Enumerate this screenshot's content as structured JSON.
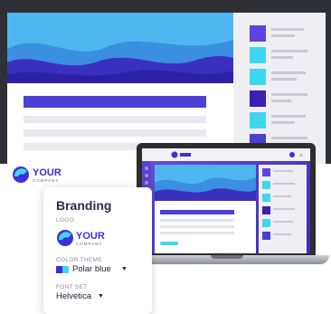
{
  "colors": {
    "accent": "#4b3fd6",
    "sky": "#4fb7f0",
    "cyan": "#3fd7f0",
    "indigo": "#3e2fd6",
    "dark": "#2f3035"
  },
  "logo": {
    "word_a": "YOUR",
    "word_b": "COMPANY"
  },
  "branding": {
    "title": "Branding",
    "logo_label": "LOGO",
    "color_theme_label": "COLOR THEME",
    "color_theme_value": "Polar blue",
    "font_set_label": "FONT SET",
    "font_set_value": "Helvetica"
  },
  "icons": {
    "dropdown": "chevron-down-icon",
    "logo_mark": "logo-mark-icon"
  },
  "sidebar_swatches": [
    "#5b44e0",
    "#3fd7f0",
    "#3fd7f0",
    "#3b1fb0",
    "#3fd7f0",
    "#4b3fd6"
  ]
}
